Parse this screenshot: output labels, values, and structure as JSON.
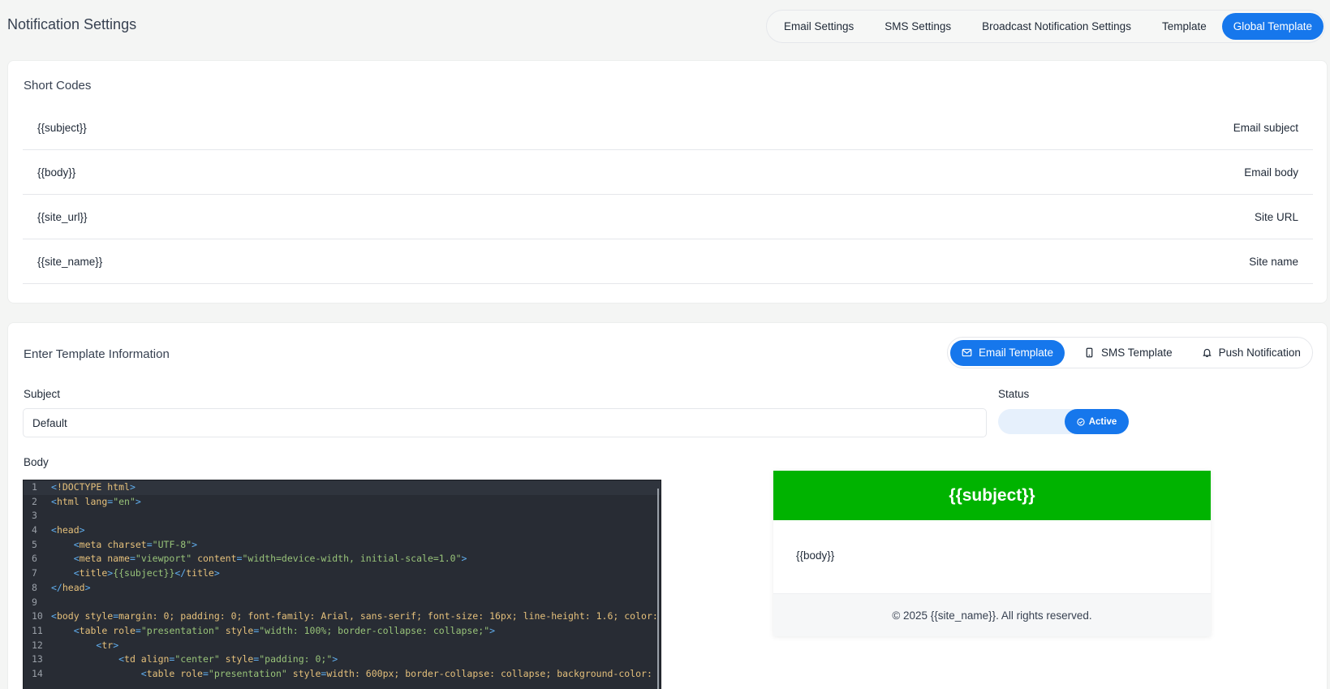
{
  "page": {
    "title": "Notification Settings"
  },
  "top_tabs": [
    {
      "label": "Email Settings",
      "active": false
    },
    {
      "label": "SMS Settings",
      "active": false
    },
    {
      "label": "Broadcast Notification Settings",
      "active": false
    },
    {
      "label": "Template",
      "active": false
    },
    {
      "label": "Global Template",
      "active": true
    }
  ],
  "short_codes": {
    "heading": "Short Codes",
    "rows": [
      {
        "code": "{{subject}}",
        "description": "Email subject"
      },
      {
        "code": "{{body}}",
        "description": "Email body"
      },
      {
        "code": "{{site_url}}",
        "description": "Site URL"
      },
      {
        "code": "{{site_name}}",
        "description": "Site name"
      }
    ]
  },
  "template": {
    "heading": "Enter Template Information",
    "tabs": [
      {
        "label": "Email Template",
        "icon": "mail-icon",
        "active": true
      },
      {
        "label": "SMS Template",
        "icon": "phone-icon",
        "active": false
      },
      {
        "label": "Push Notification",
        "icon": "bell-icon",
        "active": false
      }
    ],
    "subject_label": "Subject",
    "subject_value": "Default",
    "status_label": "Status",
    "status_value": "Active",
    "body_label": "Body"
  },
  "code_lines": [
    "<!DOCTYPE html>",
    "<html lang=\"en\">",
    "",
    "<head>",
    "    <meta charset=\"UTF-8\">",
    "    <meta name=\"viewport\" content=\"width=device-width, initial-scale=1.0\">",
    "    <title>{{subject}}</title>",
    "</head>",
    "",
    "<body style=\"margin: 0; padding: 0; font-family: Arial, sans-serif; font-size: 16px; line-height: 1.6; color:",
    "    <table role=\"presentation\" style=\"width: 100%; border-collapse: collapse;\">",
    "        <tr>",
    "            <td align=\"center\" style=\"padding: 0;\">",
    "                <table role=\"presentation\" style=\"width: 600px; border-collapse: collapse; background-color:"
  ],
  "preview": {
    "header": "{{subject}}",
    "body": "{{body}}",
    "footer": "© 2025 {{site_name}}. All rights reserved.",
    "header_color": "#00b300"
  },
  "colors": {
    "accent": "#1677ec",
    "editor_bg": "#282c34"
  }
}
